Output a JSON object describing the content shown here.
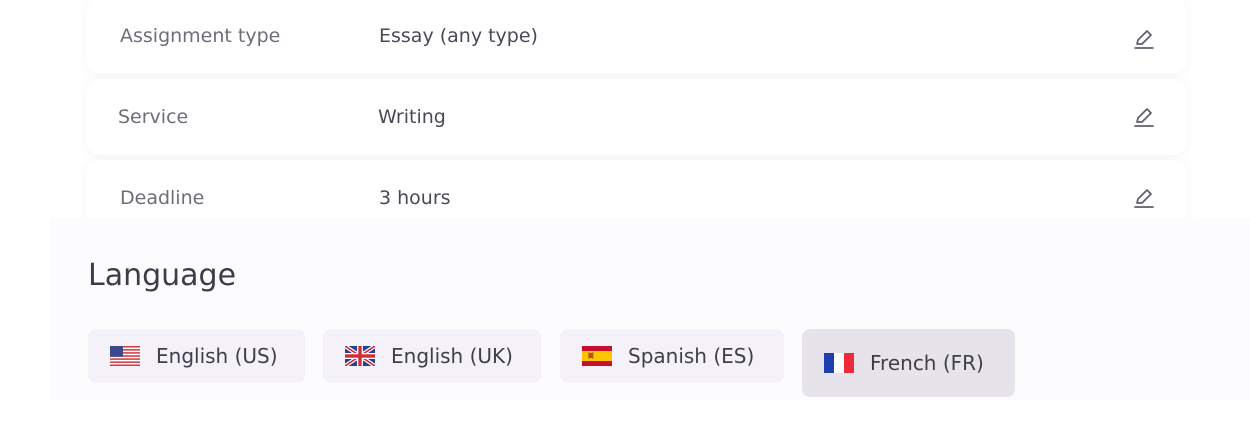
{
  "order_details": [
    {
      "label": "Assignment type",
      "value": "Essay (any type)",
      "edit_icon": "pencil-edit-icon"
    },
    {
      "label": "Service",
      "value": "Writing",
      "edit_icon": "pencil-edit-icon"
    },
    {
      "label": "Deadline",
      "value": "3 hours",
      "edit_icon": "pencil-edit-icon"
    }
  ],
  "language": {
    "title": "Language",
    "selected": "French (FR)",
    "options": [
      {
        "label": "English (US)",
        "flag": "us-flag-icon"
      },
      {
        "label": "English (UK)",
        "flag": "uk-flag-icon"
      },
      {
        "label": "Spanish (ES)",
        "flag": "spain-flag-icon"
      },
      {
        "label": "French (FR)",
        "flag": "france-flag-icon"
      }
    ]
  },
  "colors": {
    "text_primary": "#3f3e49",
    "text_label": "#6e6d78",
    "chip_background": "#f4f2f8",
    "chip_selected_background": "#e6e3ea",
    "france_blue": "#1f3fae",
    "france_red": "#ef2b39"
  }
}
